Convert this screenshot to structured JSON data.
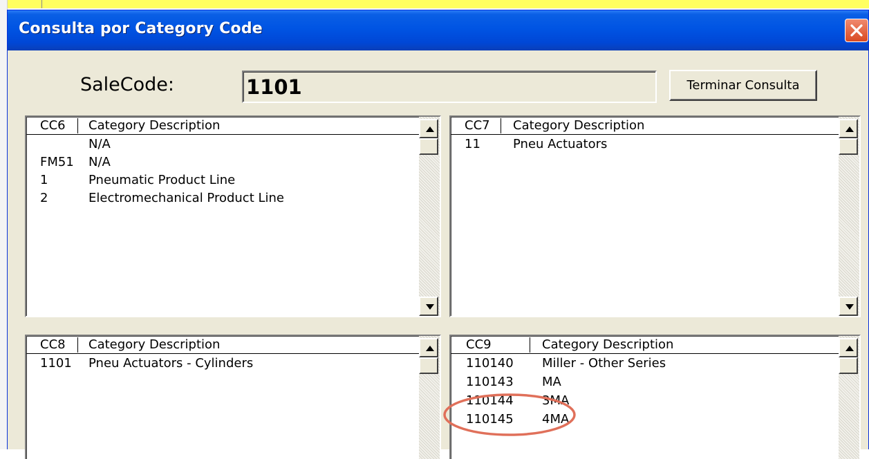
{
  "window": {
    "title": "Consulta  por  Category Code",
    "close_icon": "close-icon"
  },
  "salecode": {
    "label": "SaleCode:",
    "value": "1101"
  },
  "end_button": {
    "label": "Terminar Consulta"
  },
  "lists": {
    "cc6": {
      "col1": "CC6",
      "col2": "Category Description",
      "rows": [
        {
          "code": "",
          "desc": "N/A"
        },
        {
          "code": "FM51",
          "desc": "N/A"
        },
        {
          "code": "1",
          "desc": "Pneumatic Product Line"
        },
        {
          "code": "2",
          "desc": "Electromechanical Product Line"
        }
      ]
    },
    "cc7": {
      "col1": "CC7",
      "col2": "Category Description",
      "rows": [
        {
          "code": "11",
          "desc": "Pneu Actuators"
        }
      ]
    },
    "cc8": {
      "col1": "CC8",
      "col2": "Category Description",
      "rows": [
        {
          "code": "1101",
          "desc": "Pneu Actuators - Cylinders"
        }
      ]
    },
    "cc9": {
      "col1": "CC9",
      "col2": "Category Description",
      "rows": [
        {
          "code": "110140",
          "desc": "Miller - Other Series"
        },
        {
          "code": "110143",
          "desc": "MA"
        },
        {
          "code": "110144",
          "desc": "3MA"
        },
        {
          "code": "110145",
          "desc": "4MA"
        }
      ]
    }
  },
  "icons": {
    "scroll_up": "arrow-up-icon",
    "scroll_down": "arrow-down-icon"
  },
  "colors": {
    "titlebar": "#0054e3",
    "dialog_bg": "#ece9d8",
    "annotation": "#e0705a"
  }
}
